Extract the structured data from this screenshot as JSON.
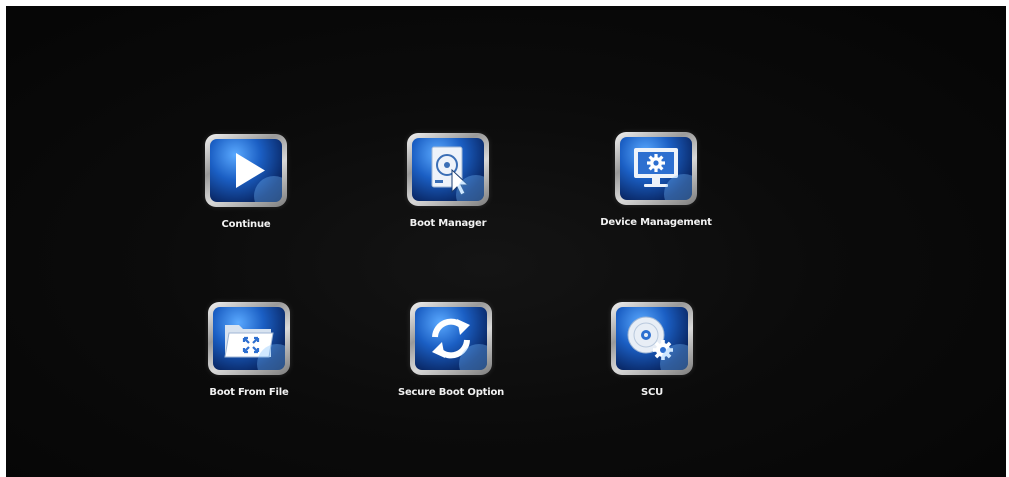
{
  "menu": {
    "items": [
      {
        "label": "Continue",
        "icon": "play-icon"
      },
      {
        "label": "Boot Manager",
        "icon": "disk-cursor-icon"
      },
      {
        "label": "Device Management",
        "icon": "monitor-gear-icon"
      },
      {
        "label": "Boot From File",
        "icon": "folder-icon"
      },
      {
        "label": "Secure Boot Option",
        "icon": "refresh-arrows-icon"
      },
      {
        "label": "SCU",
        "icon": "disc-gear-icon"
      }
    ]
  },
  "colors": {
    "background": "#0b0b0b",
    "icon_blue": "#1b5fc4",
    "label": "#f2f2f2"
  }
}
